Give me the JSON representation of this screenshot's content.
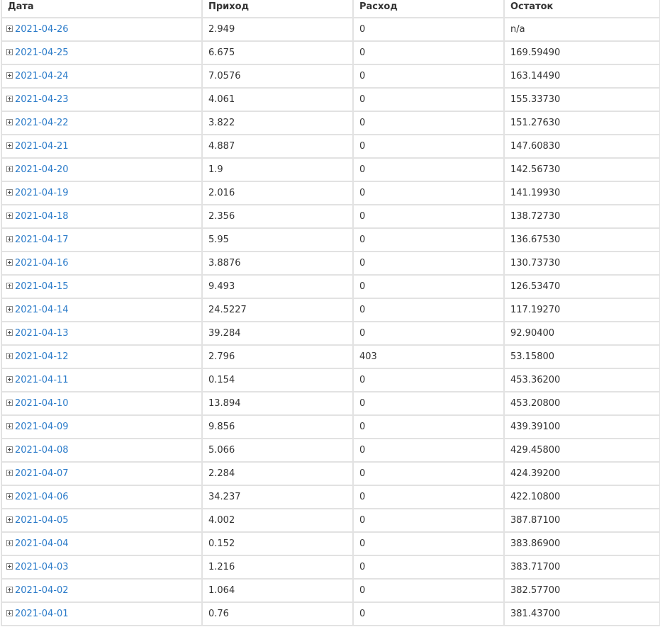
{
  "table": {
    "headers": {
      "date": "Дата",
      "income": "Приход",
      "expense": "Расход",
      "balance": "Остаток"
    },
    "rows": [
      {
        "date": "2021-04-26",
        "income": "2.949",
        "expense": "0",
        "balance": "n/a"
      },
      {
        "date": "2021-04-25",
        "income": "6.675",
        "expense": "0",
        "balance": "169.59490"
      },
      {
        "date": "2021-04-24",
        "income": "7.0576",
        "expense": "0",
        "balance": "163.14490"
      },
      {
        "date": "2021-04-23",
        "income": "4.061",
        "expense": "0",
        "balance": "155.33730"
      },
      {
        "date": "2021-04-22",
        "income": "3.822",
        "expense": "0",
        "balance": "151.27630"
      },
      {
        "date": "2021-04-21",
        "income": "4.887",
        "expense": "0",
        "balance": "147.60830"
      },
      {
        "date": "2021-04-20",
        "income": "1.9",
        "expense": "0",
        "balance": "142.56730"
      },
      {
        "date": "2021-04-19",
        "income": "2.016",
        "expense": "0",
        "balance": "141.19930"
      },
      {
        "date": "2021-04-18",
        "income": "2.356",
        "expense": "0",
        "balance": "138.72730"
      },
      {
        "date": "2021-04-17",
        "income": "5.95",
        "expense": "0",
        "balance": "136.67530"
      },
      {
        "date": "2021-04-16",
        "income": "3.8876",
        "expense": "0",
        "balance": "130.73730"
      },
      {
        "date": "2021-04-15",
        "income": "9.493",
        "expense": "0",
        "balance": "126.53470"
      },
      {
        "date": "2021-04-14",
        "income": "24.5227",
        "expense": "0",
        "balance": "117.19270"
      },
      {
        "date": "2021-04-13",
        "income": "39.284",
        "expense": "0",
        "balance": "92.90400"
      },
      {
        "date": "2021-04-12",
        "income": "2.796",
        "expense": "403",
        "balance": "53.15800"
      },
      {
        "date": "2021-04-11",
        "income": "0.154",
        "expense": "0",
        "balance": "453.36200"
      },
      {
        "date": "2021-04-10",
        "income": "13.894",
        "expense": "0",
        "balance": "453.20800"
      },
      {
        "date": "2021-04-09",
        "income": "9.856",
        "expense": "0",
        "balance": "439.39100"
      },
      {
        "date": "2021-04-08",
        "income": "5.066",
        "expense": "0",
        "balance": "429.45800"
      },
      {
        "date": "2021-04-07",
        "income": "2.284",
        "expense": "0",
        "balance": "424.39200"
      },
      {
        "date": "2021-04-06",
        "income": "34.237",
        "expense": "0",
        "balance": "422.10800"
      },
      {
        "date": "2021-04-05",
        "income": "4.002",
        "expense": "0",
        "balance": "387.87100"
      },
      {
        "date": "2021-04-04",
        "income": "0.152",
        "expense": "0",
        "balance": "383.86900"
      },
      {
        "date": "2021-04-03",
        "income": "1.216",
        "expense": "0",
        "balance": "383.71700"
      },
      {
        "date": "2021-04-02",
        "income": "1.064",
        "expense": "0",
        "balance": "382.57700"
      },
      {
        "date": "2021-04-01",
        "income": "0.76",
        "expense": "0",
        "balance": "381.43700"
      }
    ]
  },
  "icons": {
    "row_expand": "plus-square-icon"
  },
  "colors": {
    "link": "#2b7bc9",
    "border": "#e2e2e2",
    "text": "#333333"
  }
}
